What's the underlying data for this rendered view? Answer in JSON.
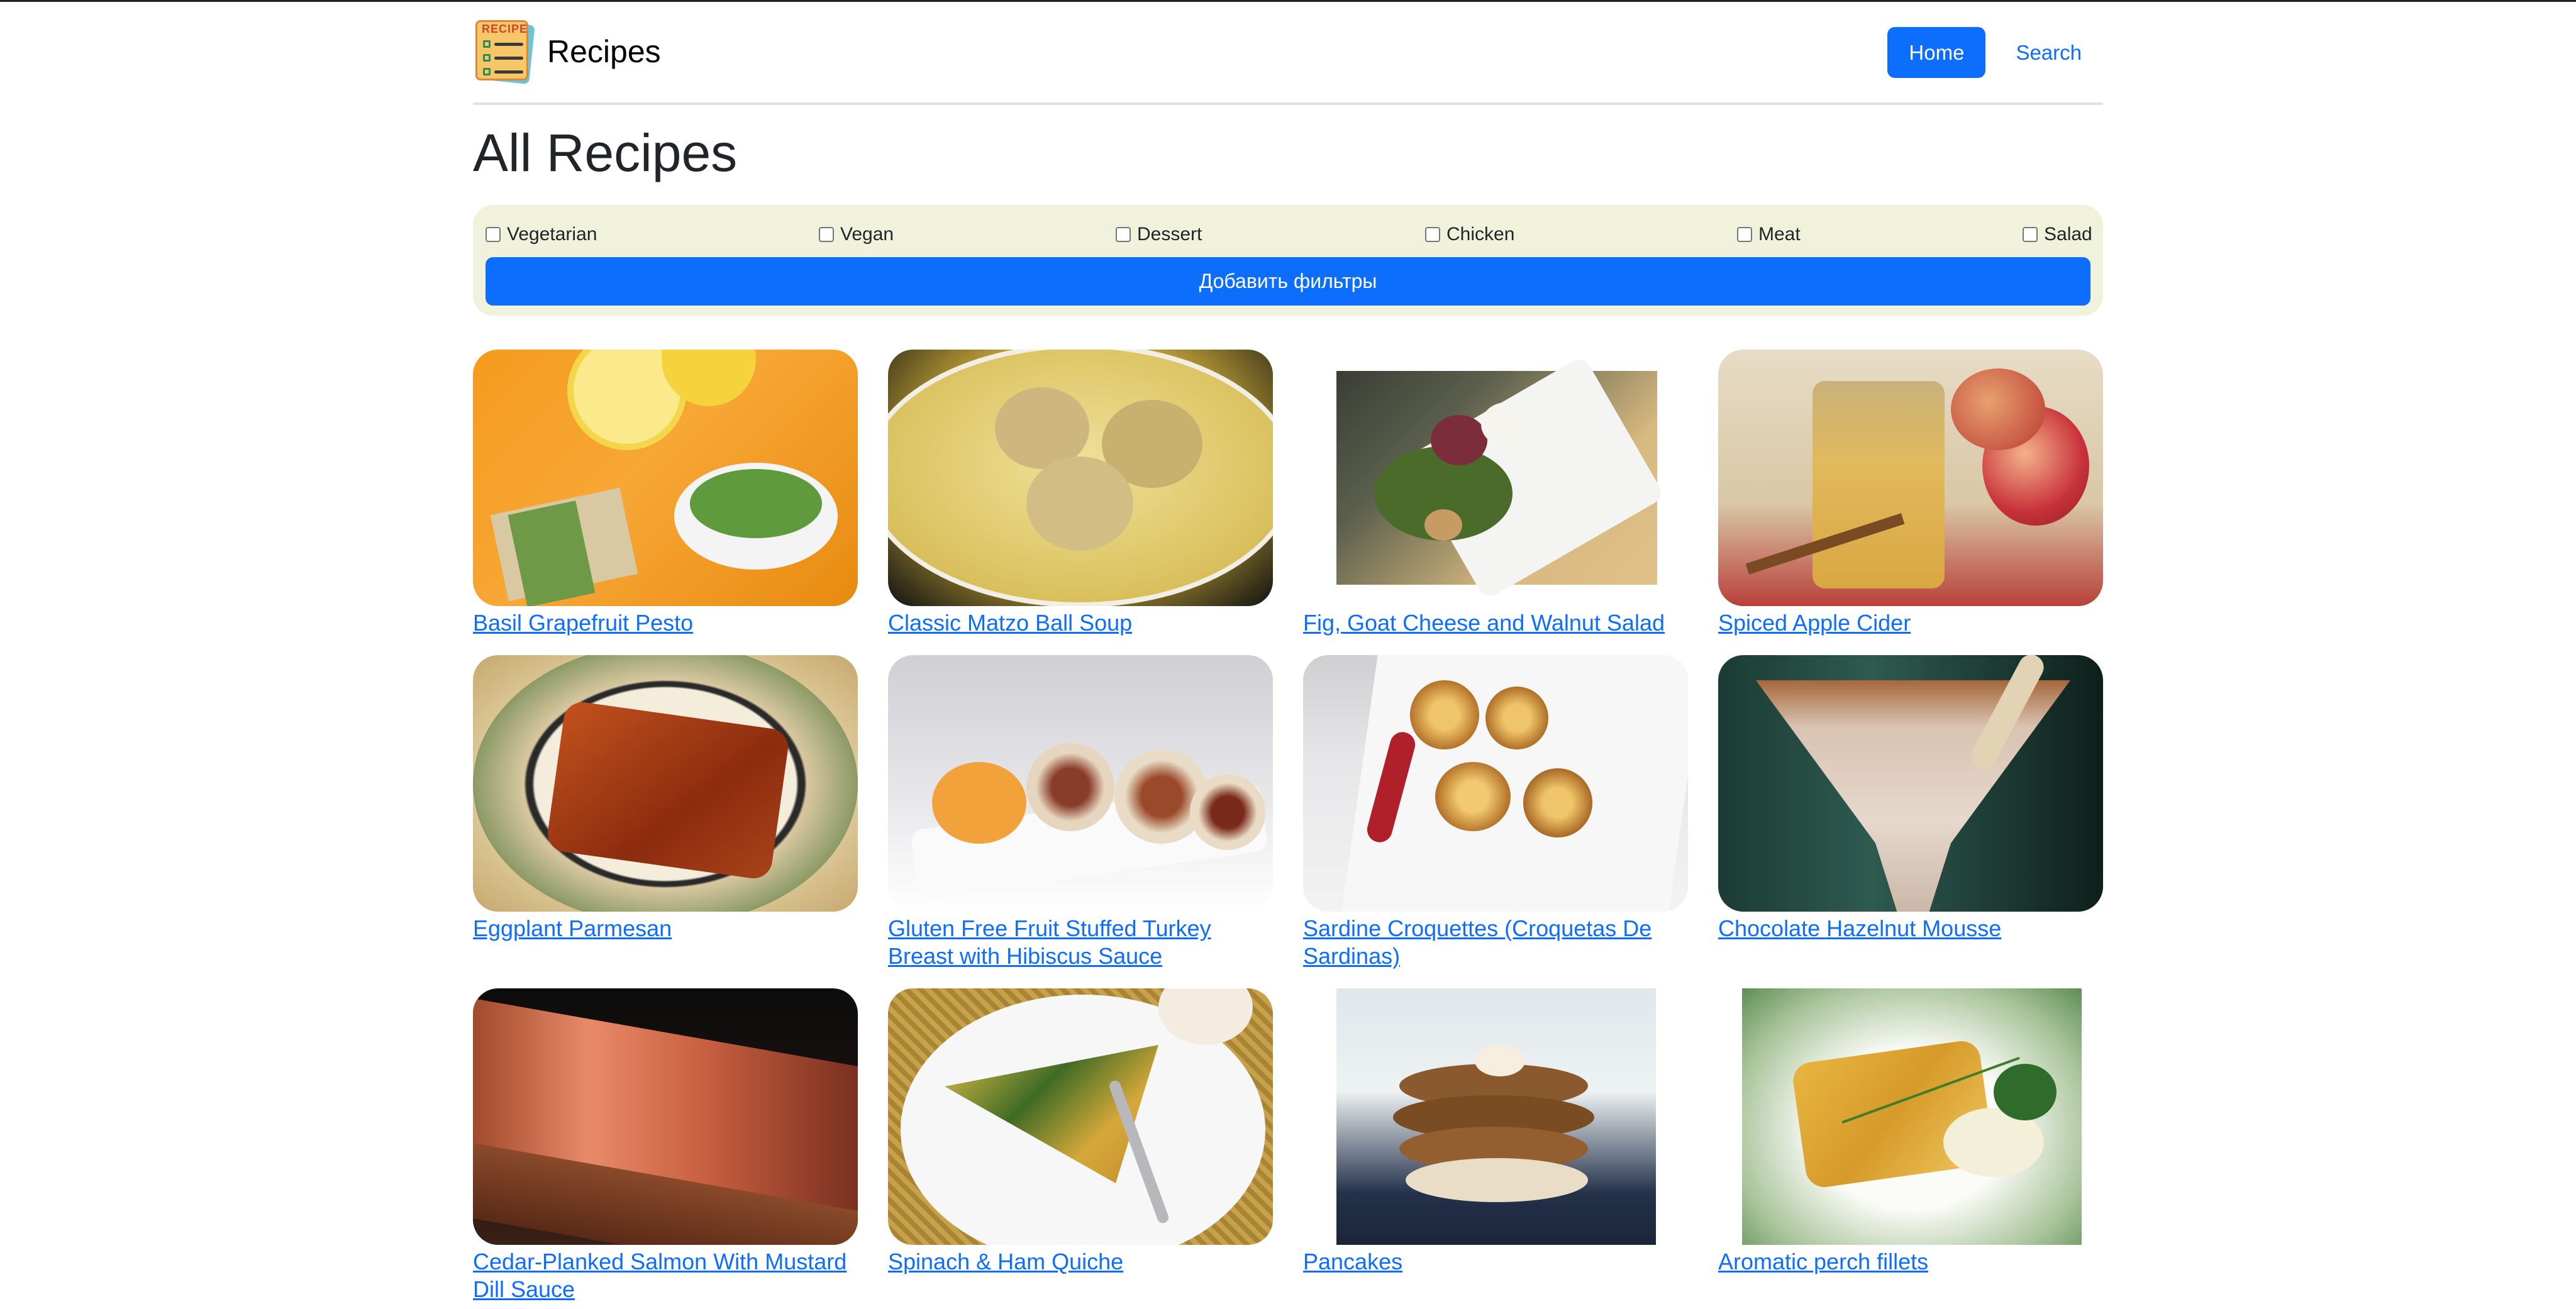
{
  "header": {
    "brand": "Recipes",
    "logo_tag": "RECIPE",
    "nav": [
      {
        "label": "Home",
        "active": true
      },
      {
        "label": "Search",
        "active": false
      }
    ]
  },
  "page": {
    "title": "All Recipes"
  },
  "filters": {
    "options": [
      "Vegetarian",
      "Vegan",
      "Dessert",
      "Chicken",
      "Meat",
      "Salad"
    ],
    "apply_label": "Добавить фильтры"
  },
  "recipes": [
    {
      "title": "Basil Grapefruit Pesto"
    },
    {
      "title": "Classic Matzo Ball Soup"
    },
    {
      "title": "Fig, Goat Cheese and Walnut Salad"
    },
    {
      "title": "Spiced Apple Cider"
    },
    {
      "title": "Eggplant Parmesan"
    },
    {
      "title": "Gluten Free Fruit Stuffed Turkey Breast with Hibiscus Sauce"
    },
    {
      "title": "Sardine Croquettes (Croquetas De Sardinas)"
    },
    {
      "title": "Chocolate Hazelnut Mousse"
    },
    {
      "title": "Cedar-Planked Salmon With Mustard Dill Sauce"
    },
    {
      "title": "Spinach & Ham Quiche"
    },
    {
      "title": "Pancakes"
    },
    {
      "title": "Aromatic perch fillets"
    }
  ],
  "colors": {
    "accent": "#0d6efd",
    "filter_bg": "#f1f2dc"
  }
}
